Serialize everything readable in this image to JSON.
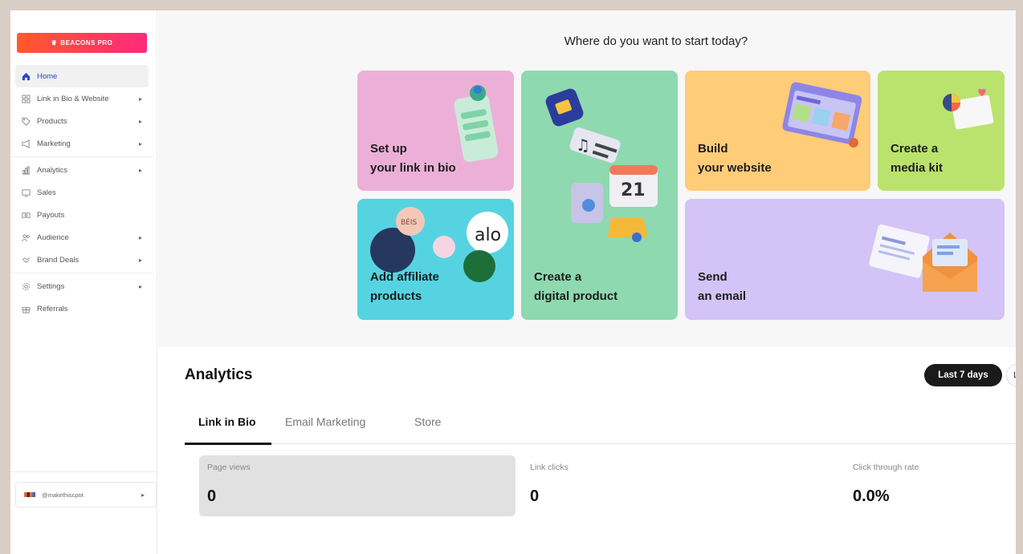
{
  "sidebar": {
    "pro_label": "BEACONS PRO",
    "items": [
      {
        "label": "Home",
        "icon": "home-icon"
      },
      {
        "label": "Link in Bio & Website",
        "icon": "grid-icon"
      },
      {
        "label": "Products",
        "icon": "tag-icon"
      },
      {
        "label": "Marketing",
        "icon": "megaphone-icon"
      },
      {
        "label": "Analytics",
        "icon": "chart-icon"
      },
      {
        "label": "Sales",
        "icon": "monitor-icon"
      },
      {
        "label": "Payouts",
        "icon": "money-icon"
      },
      {
        "label": "Audience",
        "icon": "people-icon"
      },
      {
        "label": "Brand Deals",
        "icon": "handshake-icon"
      },
      {
        "label": "Settings",
        "icon": "gear-icon"
      },
      {
        "label": "Referrals",
        "icon": "gift-icon"
      }
    ],
    "account": "@makethiscpot"
  },
  "main": {
    "heading": "Where do you want to start today?",
    "cards": {
      "link_in_bio": {
        "line1": "Set up",
        "line2": "your link in bio"
      },
      "digital_product": {
        "line1": "Create a",
        "line2": "digital product"
      },
      "website": {
        "line1": "Build",
        "line2": "your website"
      },
      "media_kit": {
        "line1": "Create a",
        "line2": "media kit"
      },
      "affiliate": {
        "line1": "Add affiliate",
        "line2": "products"
      },
      "email": {
        "line1": "Send",
        "line2": "an email"
      }
    },
    "card_art": {
      "calendar_day": "21",
      "brand_alo": "alo",
      "brand_beis": "BÉIS"
    }
  },
  "analytics": {
    "title": "Analytics",
    "range": "Last 7 days",
    "range_next": "L",
    "tabs": [
      "Link in Bio",
      "Email Marketing",
      "Store"
    ],
    "stats": [
      {
        "label": "Page views",
        "value": "0"
      },
      {
        "label": "Link clicks",
        "value": "0"
      },
      {
        "label": "Click through rate",
        "value": "0.0%"
      }
    ]
  },
  "colors": {
    "pro_gradient_start": "#ff5a2b",
    "pro_gradient_end": "#ff2a7e",
    "active_nav": "#2a43d6",
    "card_pink": "#ecb0d8",
    "card_green": "#8fd9b0",
    "card_orange": "#ffcc78",
    "card_lime": "#b9e36c",
    "card_cyan": "#56d3e1",
    "card_lavender": "#d4c3f6"
  }
}
